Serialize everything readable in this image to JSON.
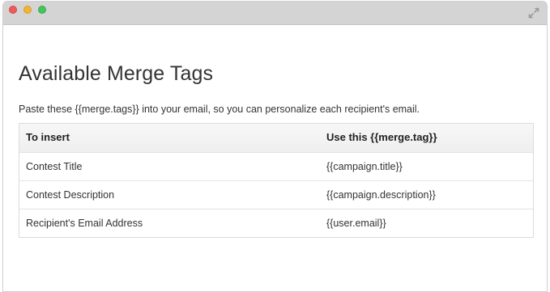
{
  "window": {
    "controls": [
      "close",
      "minimize",
      "maximize"
    ],
    "expand_icon": "expand-arrows-icon"
  },
  "page": {
    "title": "Available Merge Tags",
    "subtitle": "Paste these {{merge.tags}} into your email, so you can personalize each recipient's email."
  },
  "table": {
    "headers": [
      "To insert",
      "Use this {{merge.tag}}"
    ],
    "rows": [
      {
        "label": "Contest Title",
        "tag": "{{campaign.title}}"
      },
      {
        "label": "Contest Description",
        "tag": "{{campaign.description}}"
      },
      {
        "label": "Recipient's Email Address",
        "tag": "{{user.email}}"
      }
    ]
  },
  "colors": {
    "close": "#ee5b5b",
    "minimize": "#f0b43a",
    "maximize": "#43c55a",
    "titlebar": "#d4d4d4",
    "text": "#333333"
  }
}
